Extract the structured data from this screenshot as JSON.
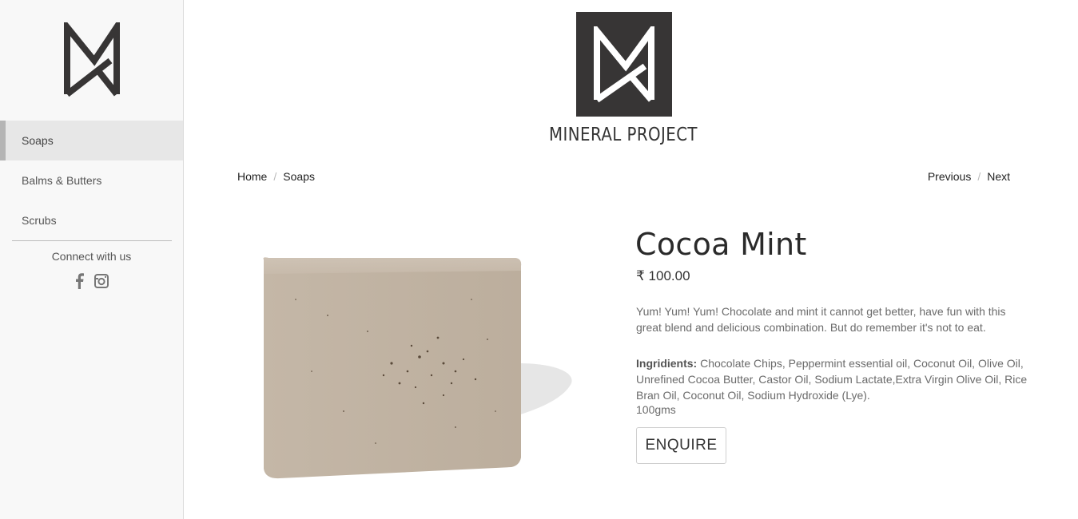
{
  "sidebar": {
    "logo_icon": "mineral-project-monogram",
    "items": [
      {
        "label": "Soaps",
        "active": true
      },
      {
        "label": "Balms & Butters",
        "active": false
      },
      {
        "label": "Scrubs",
        "active": false
      }
    ],
    "connect_label": "Connect with us",
    "social": [
      {
        "icon": "facebook-icon",
        "glyph": "f"
      },
      {
        "icon": "instagram-icon"
      }
    ]
  },
  "brand": {
    "name": "MINERAL PROJECT",
    "logo_bg": "#373535"
  },
  "breadcrumb": {
    "home": "Home",
    "separator": "/",
    "current": "Soaps"
  },
  "pager": {
    "previous": "Previous",
    "separator": "/",
    "next": "Next"
  },
  "product": {
    "name": "Cocoa Mint",
    "price": "₹ 100.00",
    "description": "Yum! Yum! Yum! Chocolate and mint it cannot get better, have fun with this great blend and delicious combination. But do remember it's not to eat.",
    "ingredients_label": "Ingridients:",
    "ingredients": " Chocolate Chips, Peppermint essential oil, Coconut Oil, Olive Oil, Unrefined Cocoa Butter, Castor Oil, Sodium Lactate,Extra Virgin Olive Oil, Rice Bran Oil, Coconut Oil, Sodium Hydroxide (Lye).",
    "weight": "100gms",
    "enquire_label": "ENQUIRE"
  }
}
